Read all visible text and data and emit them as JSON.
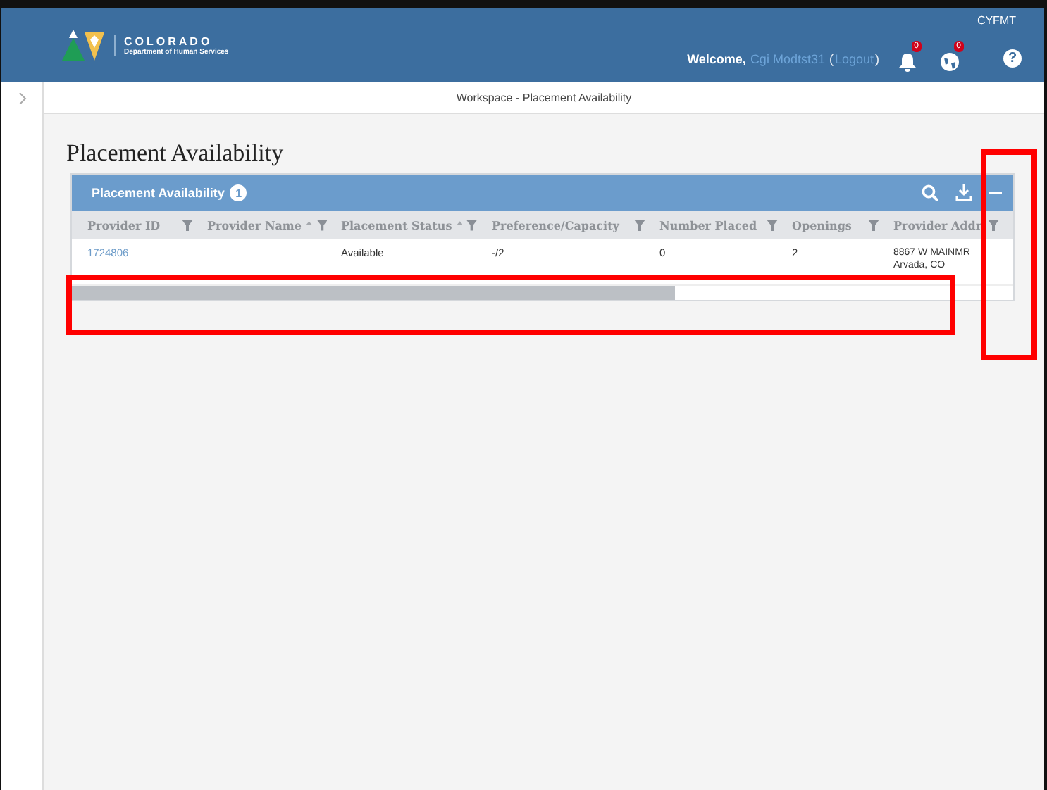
{
  "header": {
    "logo_title": "COLORADO",
    "logo_subtitle": "Department of Human Services",
    "agency": "CYFMT",
    "welcome": "Welcome,",
    "user_name": "Cgi Modtst31",
    "logout_open": "(",
    "logout": "Logout",
    "logout_close": ")",
    "notifications_badge": "0",
    "alerts_badge": "0",
    "help": "?"
  },
  "breadcrumb": "Workspace - Placement Availability",
  "page_title": "Placement Availability",
  "panel": {
    "title": "Placement Availability",
    "count": "1",
    "columns": [
      {
        "label": "Provider ID",
        "sortable": false
      },
      {
        "label": "Provider Name",
        "sortable": true
      },
      {
        "label": "Placement Status",
        "sortable": true
      },
      {
        "label": "Preference/Capacity",
        "sortable": false
      },
      {
        "label": "Number Placed",
        "sortable": false
      },
      {
        "label": "Openings",
        "sortable": false
      },
      {
        "label": "Provider Addr",
        "sortable": false
      }
    ],
    "rows": [
      {
        "cells": [
          "1724806",
          "",
          "Available",
          "-/2",
          "0",
          "2",
          "8867 W MAINMR Arvada, CO"
        ]
      }
    ]
  },
  "annotations": [
    {
      "kind": "highlight"
    },
    {
      "kind": "highlight"
    }
  ]
}
